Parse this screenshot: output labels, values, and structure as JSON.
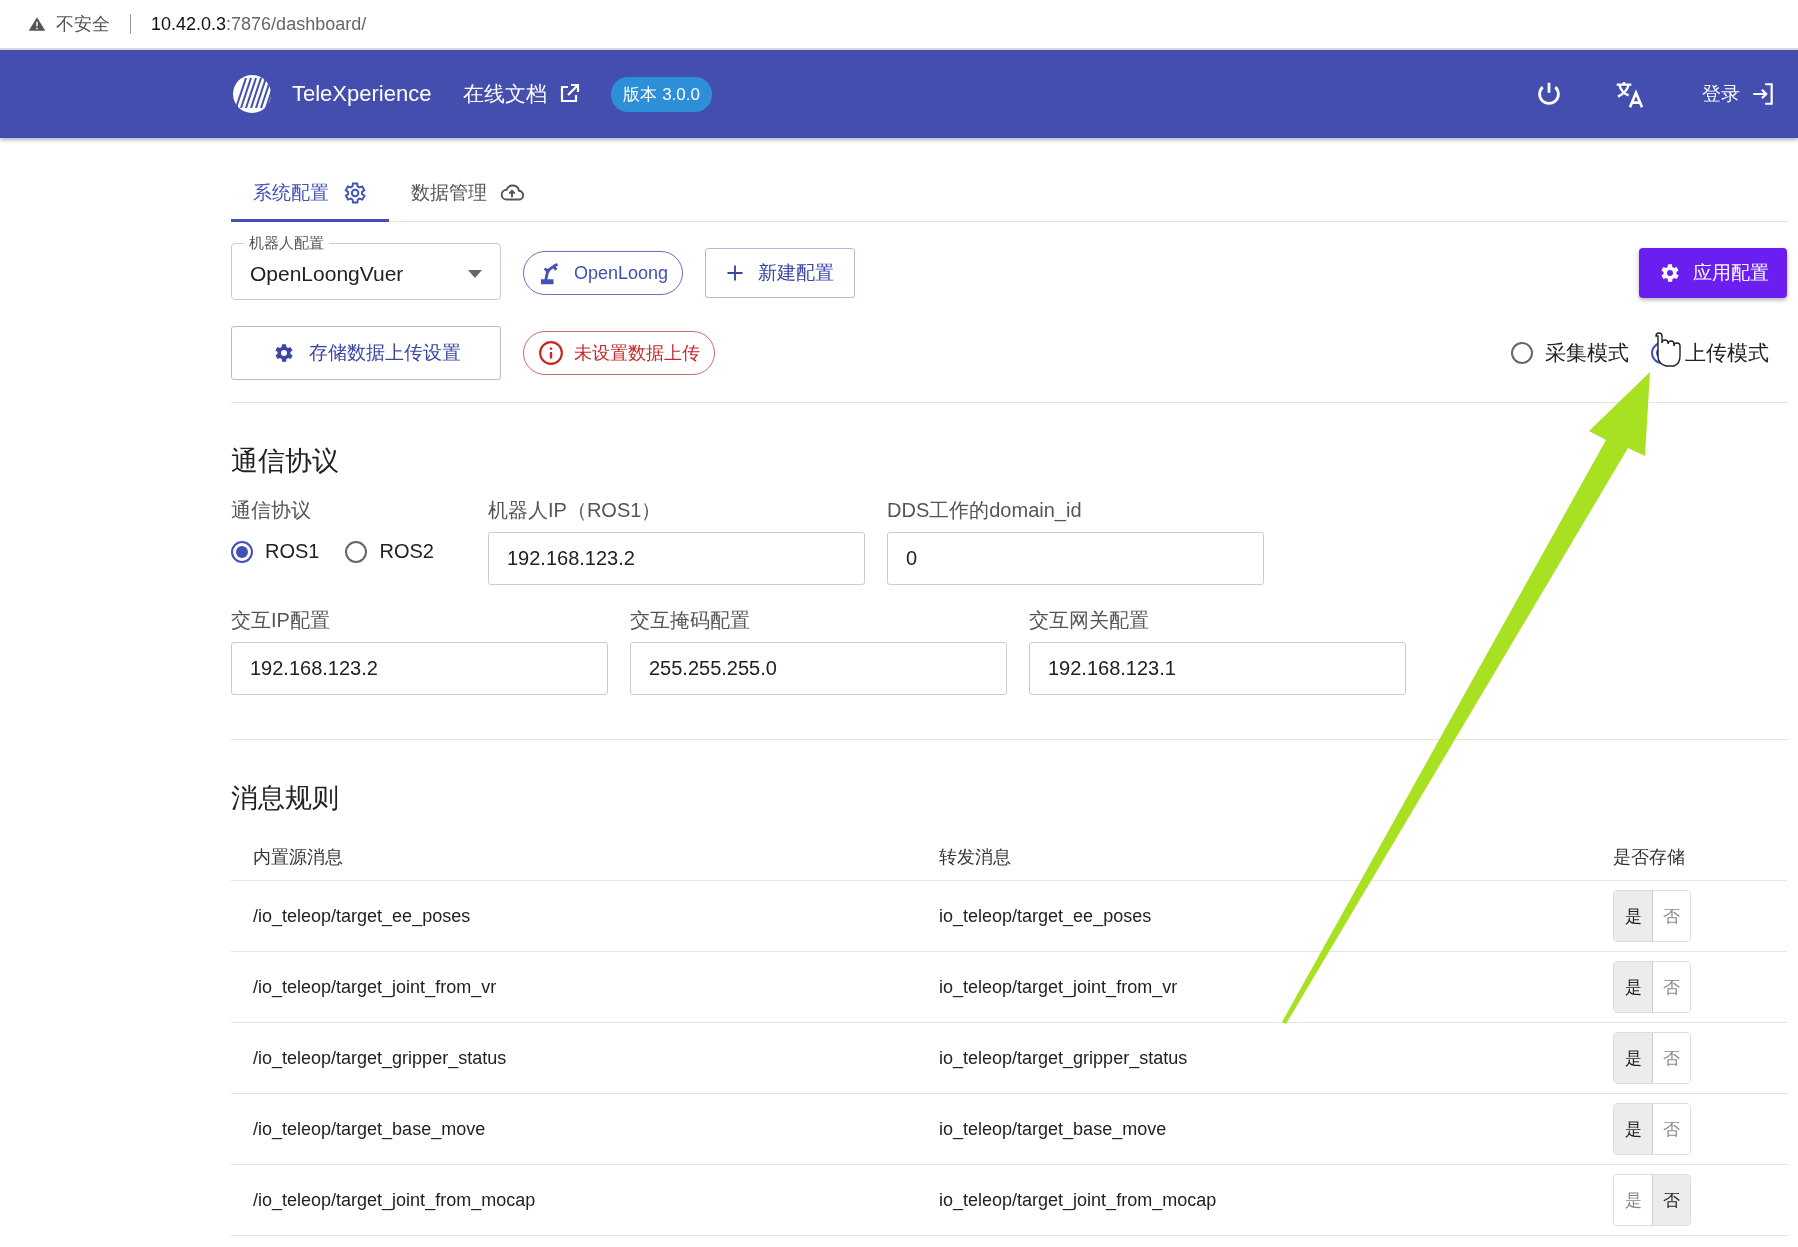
{
  "browser": {
    "security": "不安全",
    "url": {
      "host": "10.42.0.3",
      "rest": ":7876/dashboard/"
    }
  },
  "header": {
    "title": "TeleXperience",
    "docs_link": "在线文档",
    "version": "版本 3.0.0",
    "login": "登录"
  },
  "tabs": [
    {
      "label": "系统配置",
      "selected": true
    },
    {
      "label": "数据管理",
      "selected": false
    }
  ],
  "config": {
    "select": {
      "label": "机器人配置",
      "value": "OpenLoongVuer"
    },
    "robot_chip": "OpenLoong",
    "new_button": "新建配置",
    "apply_button": "应用配置",
    "upload_settings_button": "存储数据上传设置",
    "upload_status": "未设置数据上传",
    "modes": [
      {
        "label": "采集模式",
        "selected": false
      },
      {
        "label": "上传模式",
        "selected": true
      }
    ]
  },
  "protocol": {
    "title": "通信协议",
    "radio_label": "通信协议",
    "options": [
      {
        "label": "ROS1",
        "selected": true
      },
      {
        "label": "ROS2",
        "selected": false
      }
    ],
    "fields": [
      {
        "label": "机器人IP（ROS1）",
        "value": "192.168.123.2"
      },
      {
        "label": "DDS工作的domain_id",
        "value": "0"
      },
      {
        "label": "交互IP配置",
        "value": "192.168.123.2"
      },
      {
        "label": "交互掩码配置",
        "value": "255.255.255.0"
      },
      {
        "label": "交互网关配置",
        "value": "192.168.123.1"
      }
    ]
  },
  "rules": {
    "title": "消息规则",
    "columns": [
      "内置源消息",
      "转发消息",
      "是否存储"
    ],
    "rows": [
      {
        "source": "/io_teleop/target_ee_poses",
        "forward": "io_teleop/target_ee_poses",
        "options": [
          {
            "label": "是",
            "selected": true
          },
          {
            "label": "否",
            "selected": false
          }
        ]
      },
      {
        "source": "/io_teleop/target_joint_from_vr",
        "forward": "io_teleop/target_joint_from_vr",
        "options": [
          {
            "label": "是",
            "selected": true
          },
          {
            "label": "否",
            "selected": false
          }
        ]
      },
      {
        "source": "/io_teleop/target_gripper_status",
        "forward": "io_teleop/target_gripper_status",
        "options": [
          {
            "label": "是",
            "selected": true
          },
          {
            "label": "否",
            "selected": false
          }
        ]
      },
      {
        "source": "/io_teleop/target_base_move",
        "forward": "io_teleop/target_base_move",
        "options": [
          {
            "label": "是",
            "selected": true
          },
          {
            "label": "否",
            "selected": false
          }
        ]
      },
      {
        "source": "/io_teleop/target_joint_from_mocap",
        "forward": "io_teleop/target_joint_from_mocap",
        "options": [
          {
            "label": "是",
            "selected": false
          },
          {
            "label": "否",
            "selected": true
          }
        ]
      }
    ]
  }
}
